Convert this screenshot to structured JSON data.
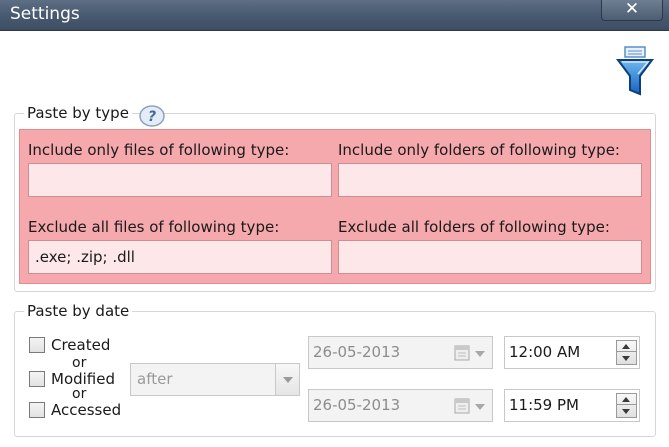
{
  "window": {
    "title": "Settings",
    "close_label": "✕"
  },
  "paste_by_type": {
    "legend": "Paste by type",
    "include_files_label": "Include only files of following type:",
    "include_files_value": "",
    "include_folders_label": "Include only folders of following type:",
    "include_folders_value": "",
    "exclude_files_label": "Exclude all files of following type:",
    "exclude_files_value": ".exe; .zip; .dll",
    "exclude_folders_label": "Exclude all folders of following type:",
    "exclude_folders_value": "",
    "highlight_color": "#f5a9ad"
  },
  "paste_by_date": {
    "legend": "Paste by date",
    "created_label": "Created",
    "modified_label": "Modified",
    "accessed_label": "Accessed",
    "or_1": "or",
    "or_2": "or",
    "condition_selected": "after",
    "date_from": "26-05-2013",
    "time_from": "12:00 AM",
    "date_to": "26-05-2013",
    "time_to": "11:59 PM"
  },
  "icons": {
    "filter": "filter-funnel-icon",
    "help": "help-question-icon",
    "calendar": "calendar-icon"
  }
}
